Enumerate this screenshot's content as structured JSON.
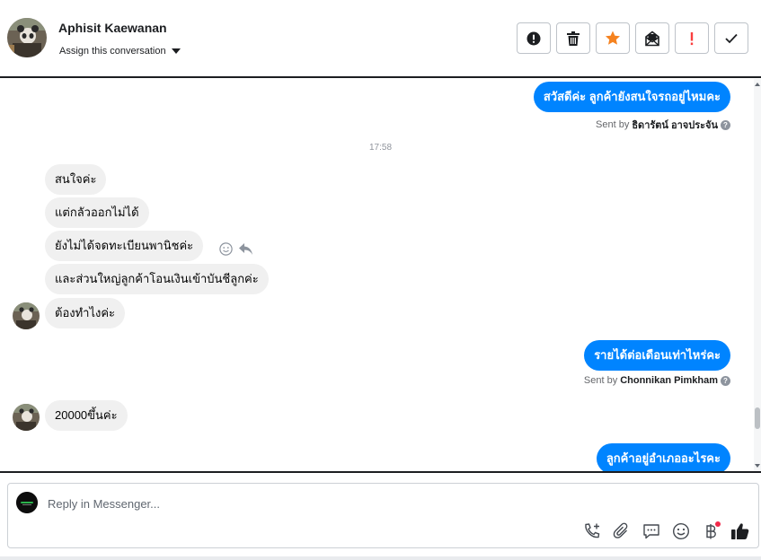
{
  "header": {
    "contact_name": "Aphisit Kaewanan",
    "assign_label": "Assign this conversation",
    "actions": [
      {
        "name": "spam-alert-icon",
        "label": "Mark as spam"
      },
      {
        "name": "trash-icon",
        "label": "Delete"
      },
      {
        "name": "star-icon",
        "label": "Star",
        "color": "#f5821f"
      },
      {
        "name": "mail-icon",
        "label": "Mark as unread"
      },
      {
        "name": "exclamation-icon",
        "label": "Follow up",
        "color": "#fa3e3e"
      },
      {
        "name": "check-icon",
        "label": "Mark as done"
      }
    ]
  },
  "messages": [
    {
      "dir": "out",
      "text": "สวัสดีค่ะ ลูกค้ายังสนใจรถอยู่ไหมคะ"
    },
    {
      "dir": "meta",
      "sent_by_prefix": "Sent by",
      "sent_by_name": "ธิดารัตน์ อาจประจัน"
    },
    {
      "dir": "time",
      "text": "17:58"
    },
    {
      "dir": "in",
      "text": "สนใจค่ะ"
    },
    {
      "dir": "in",
      "text": "แต่กลัวออกไม่ได้"
    },
    {
      "dir": "in",
      "text": "ยังไม่ได้จดทะเบียนพานิชค่ะ"
    },
    {
      "dir": "in",
      "text": "และส่วนใหญ่ลูกค้าโอนเงินเข้าบันชีลูกค่ะ"
    },
    {
      "dir": "in",
      "text": "ต้องทำไงค่ะ"
    },
    {
      "dir": "out",
      "text": "รายได้ต่อเดือนเท่าไหร่คะ"
    },
    {
      "dir": "meta",
      "sent_by_prefix": "Sent by",
      "sent_by_name": "Chonnikan Pimkham"
    },
    {
      "dir": "in",
      "text": "20000ขึ้นค่ะ"
    },
    {
      "dir": "out",
      "text": "ลูกค้าอยู่อำเภออะไรคะ"
    }
  ],
  "composer": {
    "placeholder": "Reply in Messenger...",
    "tools": [
      "call-add-icon",
      "attachment-icon",
      "saved-replies-icon",
      "emoji-icon",
      "baht-payment-icon",
      "like-icon"
    ]
  },
  "colors": {
    "accent": "#0084ff",
    "incoming_bubble": "#f0f0f0",
    "star": "#f5821f",
    "alert": "#fa3e3e"
  }
}
